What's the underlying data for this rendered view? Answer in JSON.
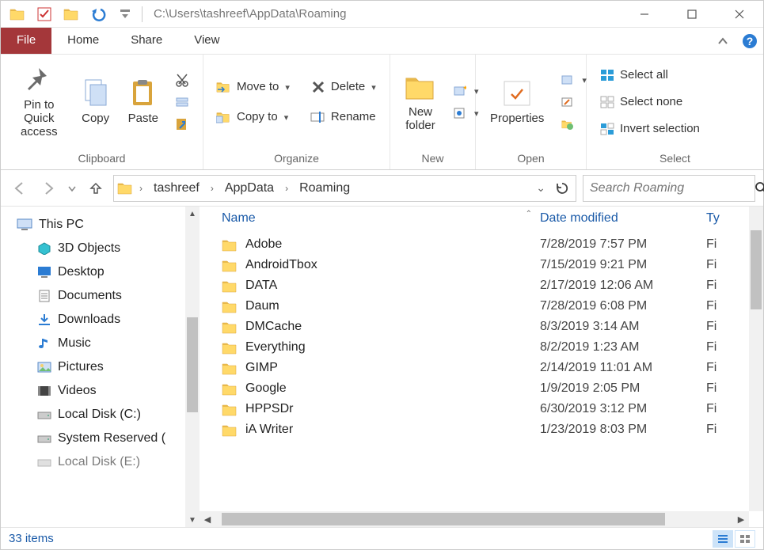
{
  "titlebar": {
    "path": "C:\\Users\\tashreef\\AppData\\Roaming"
  },
  "tabs": {
    "file": "File",
    "home": "Home",
    "share": "Share",
    "view": "View"
  },
  "ribbon": {
    "clipboard": {
      "pin": "Pin to Quick access",
      "copy": "Copy",
      "paste": "Paste",
      "label": "Clipboard"
    },
    "organize": {
      "moveto": "Move to",
      "copyto": "Copy to",
      "delete": "Delete",
      "rename": "Rename",
      "label": "Organize"
    },
    "new": {
      "newfolder": "New folder",
      "label": "New"
    },
    "open": {
      "properties": "Properties",
      "label": "Open"
    },
    "select": {
      "all": "Select all",
      "none": "Select none",
      "invert": "Invert selection",
      "label": "Select"
    }
  },
  "breadcrumbs": [
    "tashreef",
    "AppData",
    "Roaming"
  ],
  "search_placeholder": "Search Roaming",
  "columns": {
    "name": "Name",
    "date": "Date modified",
    "type": "Ty"
  },
  "nav": {
    "thispc": "This PC",
    "items": [
      "3D Objects",
      "Desktop",
      "Documents",
      "Downloads",
      "Music",
      "Pictures",
      "Videos",
      "Local Disk (C:)",
      "System Reserved (",
      "Local Disk (E:)"
    ]
  },
  "files": [
    {
      "name": "Adobe",
      "date": "7/28/2019 7:57 PM",
      "type": "Fi"
    },
    {
      "name": "AndroidTbox",
      "date": "7/15/2019 9:21 PM",
      "type": "Fi"
    },
    {
      "name": "DATA",
      "date": "2/17/2019 12:06 AM",
      "type": "Fi"
    },
    {
      "name": "Daum",
      "date": "7/28/2019 6:08 PM",
      "type": "Fi"
    },
    {
      "name": "DMCache",
      "date": "8/3/2019 3:14 AM",
      "type": "Fi"
    },
    {
      "name": "Everything",
      "date": "8/2/2019 1:23 AM",
      "type": "Fi"
    },
    {
      "name": "GIMP",
      "date": "2/14/2019 11:01 AM",
      "type": "Fi"
    },
    {
      "name": "Google",
      "date": "1/9/2019 2:05 PM",
      "type": "Fi"
    },
    {
      "name": "HPPSDr",
      "date": "6/30/2019 3:12 PM",
      "type": "Fi"
    },
    {
      "name": "iA Writer",
      "date": "1/23/2019 8:03 PM",
      "type": "Fi"
    }
  ],
  "status": {
    "count": "33 items"
  }
}
